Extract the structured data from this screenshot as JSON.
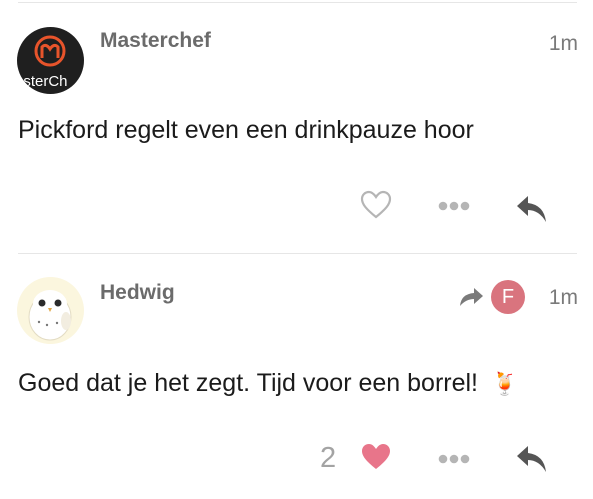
{
  "posts": [
    {
      "username": "Masterchef",
      "avatar_text": "asterCh",
      "avatar_logo": "M",
      "time": "1m",
      "content": "Pickford regelt even een drinkpauze hoor",
      "liked": false,
      "like_count": "",
      "icons": [
        "heart-outline-icon",
        "more-dots-icon",
        "reply-arrow-icon"
      ]
    },
    {
      "username": "Hedwig",
      "time": "1m",
      "reply_to_initial": "F",
      "reply_badge_color": "#d9747e",
      "content": "Goed dat je het zegt. Tijd voor een borrel!",
      "emoji": "🍹",
      "liked": true,
      "like_count": "2",
      "icons": [
        "share-arrow-icon",
        "heart-filled-icon",
        "more-dots-icon",
        "reply-arrow-icon"
      ]
    }
  ],
  "colors": {
    "heart_liked": "#e8758a",
    "icon_gray": "#555555",
    "icon_light": "#b5b5b5",
    "logo_orange": "#e8542b"
  }
}
